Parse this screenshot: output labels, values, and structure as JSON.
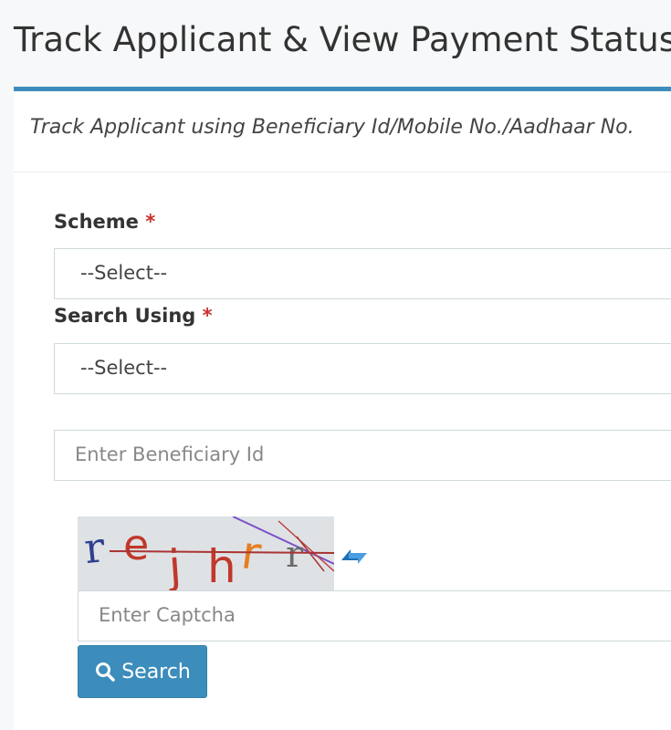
{
  "page": {
    "title": "Track Applicant & View Payment Status"
  },
  "panel": {
    "subtitle": "Track Applicant using Beneficiary Id/Mobile No./Aadhaar No."
  },
  "form": {
    "scheme": {
      "label": "Scheme",
      "required_mark": "*",
      "selected": "--Select--"
    },
    "search_using": {
      "label": "Search Using",
      "required_mark": "*",
      "selected": "--Select--"
    },
    "beneficiary_id": {
      "placeholder": "Enter Beneficiary Id"
    },
    "captcha": {
      "text": "rejhrr",
      "input_placeholder": "Enter Captcha",
      "refresh_icon": "refresh-icon"
    },
    "search_button": {
      "label": "Search",
      "icon": "search-icon"
    }
  },
  "colors": {
    "accent": "#3c8dbc",
    "required": "#c9302c"
  }
}
